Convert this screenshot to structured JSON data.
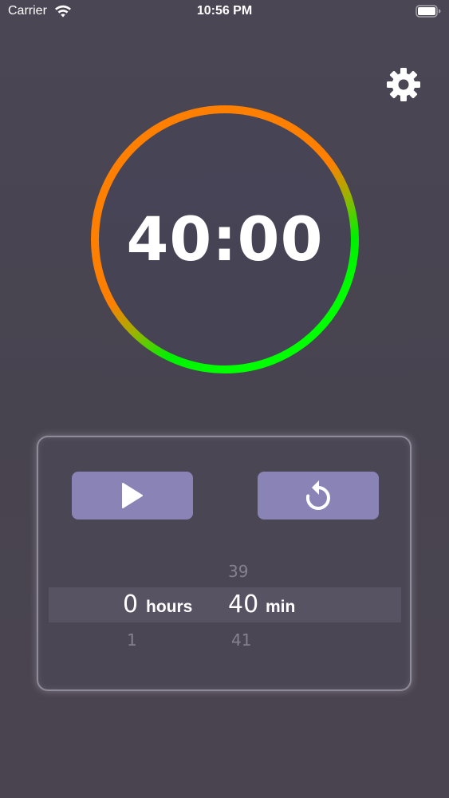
{
  "status_bar": {
    "carrier": "Carrier",
    "time": "10:56 PM",
    "icons": [
      "wifi-icon",
      "battery-icon"
    ]
  },
  "timer": {
    "display": "40:00",
    "ring_colors": [
      "#ff7f00",
      "#00ff00"
    ]
  },
  "settings": {
    "icon": "gear-icon"
  },
  "controls": {
    "play_icon": "play-icon",
    "reset_icon": "reset-icon",
    "button_color": "#8a84b6"
  },
  "picker": {
    "hours": {
      "prev": "",
      "selected": "0",
      "next": "1",
      "unit": "hours"
    },
    "minutes": {
      "prev": "39",
      "selected": "40",
      "next": "41",
      "unit": "min"
    }
  }
}
